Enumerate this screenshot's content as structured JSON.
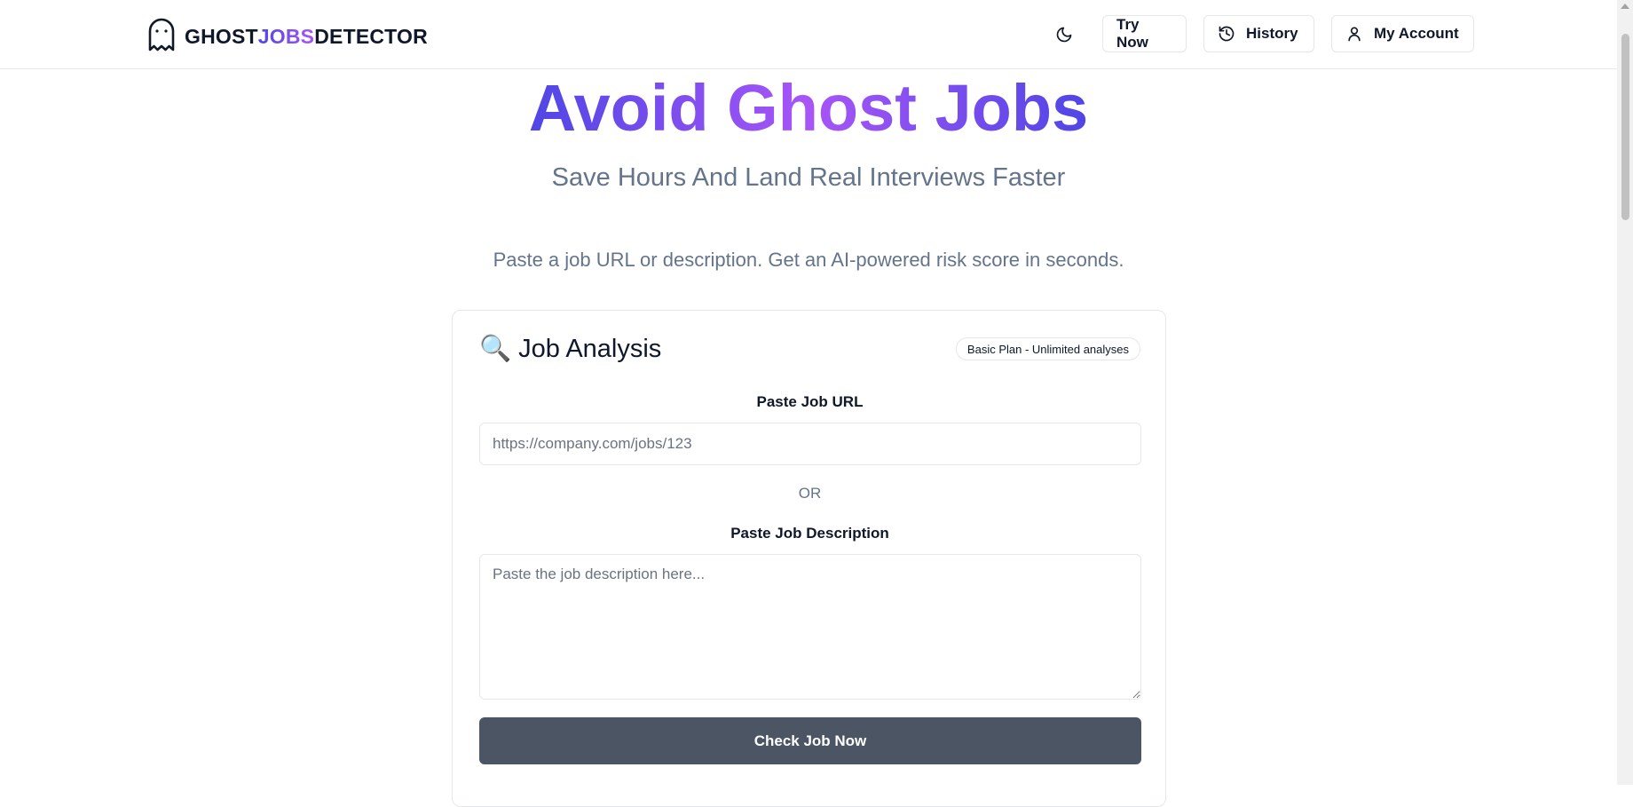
{
  "header": {
    "brand": {
      "part1": "GHOST",
      "part2": "JOBS",
      "part3": "DETECTOR"
    },
    "nav": {
      "try_now": "Try Now",
      "history": "History",
      "my_account": "My Account"
    }
  },
  "hero": {
    "title": "Avoid Ghost Jobs",
    "subtitle": "Save Hours And Land Real Interviews Faster",
    "description": "Paste a job URL or description. Get an AI-powered risk score in seconds."
  },
  "analysis": {
    "emoji": "🔍",
    "title": "Job Analysis",
    "plan_badge": "Basic Plan - Unlimited analyses",
    "url_label": "Paste Job URL",
    "url_placeholder": "https://company.com/jobs/123",
    "url_value": "",
    "or_text": "OR",
    "desc_label": "Paste Job Description",
    "desc_placeholder": "Paste the job description here...",
    "desc_value": "",
    "submit_label": "Check Job Now"
  },
  "colors": {
    "brand_gradient_start": "#4f46e5",
    "brand_gradient_end": "#a855f7",
    "button_bg": "#4b5563",
    "muted_text": "#64748b"
  },
  "icons": {
    "logo": "ghost-icon",
    "theme": "moon-icon",
    "history": "history-icon",
    "account": "user-icon"
  }
}
